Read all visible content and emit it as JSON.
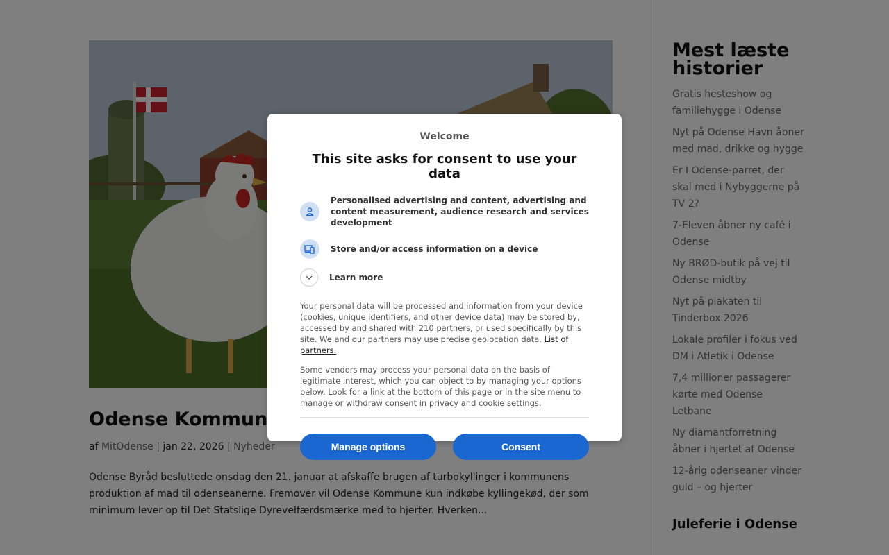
{
  "article": {
    "title": "Odense Kommune afskaffer turbokyllinger",
    "meta_prefix": "af",
    "author": "MitOdense",
    "sep1": "|",
    "date": "jan 22, 2026",
    "sep2": "|",
    "category": "Nyheder",
    "excerpt": "Odense Byråd besluttede onsdag den 21. januar at afskaffe brugen af turbokyllinger i kommunens produktion af mad til odenseanerne. Fremover vil Odense Kommune kun indkøbe kyllingekød, der som minimum lever op til Det Statslige Dyrevelfærdsmærke med to hjerter. Hverken..."
  },
  "sidebar": {
    "heading": "Mest læste historier",
    "items": [
      "Gratis hesteshow og familiehygge i Odense",
      "Nyt på Odense Havn åbner med mad, drikke og hygge",
      "Er I Odense-parret, der skal med i Nybyggerne på TV 2?",
      "7-Eleven åbner ny café i Odense",
      "Ny BRØD-butik på vej til Odense midtby",
      "Nyt på plakaten til Tinderbox 2026",
      "Lokale profiler i fokus ved DM i Atletik i Odense",
      "7,4 millioner passagerer kørte med Odense Letbane",
      "Ny diamantforretning åbner i hjertet af Odense",
      "12-årig odenseaner vinder guld – og hjerter"
    ],
    "heading2": "Juleferie i Odense"
  },
  "consent": {
    "welcome": "Welcome",
    "title": "This site asks for consent to use your data",
    "purposes": [
      {
        "icon": "person-icon",
        "text": "Personalised advertising and content, advertising and content measurement, audience research and services development"
      },
      {
        "icon": "devices-icon",
        "text": "Store and/or access information on a device"
      }
    ],
    "learn_more": "Learn more",
    "paragraph1": "Your personal data will be processed and information from your device (cookies, unique identifiers, and other device data) may be stored by, accessed by and shared with 210 partners, or used specifically by this site. We and our partners may use precise geolocation data.",
    "partners_link": "List of partners.",
    "paragraph2": "Some vendors may process your personal data on the basis of legitimate interest, which you can object to by managing your options below. Look for a link at the bottom of this page or in the site menu to manage or withdraw consent in privacy and cookie settings.",
    "manage_button": "Manage options",
    "consent_button": "Consent",
    "button_color": "#1a67d2"
  }
}
